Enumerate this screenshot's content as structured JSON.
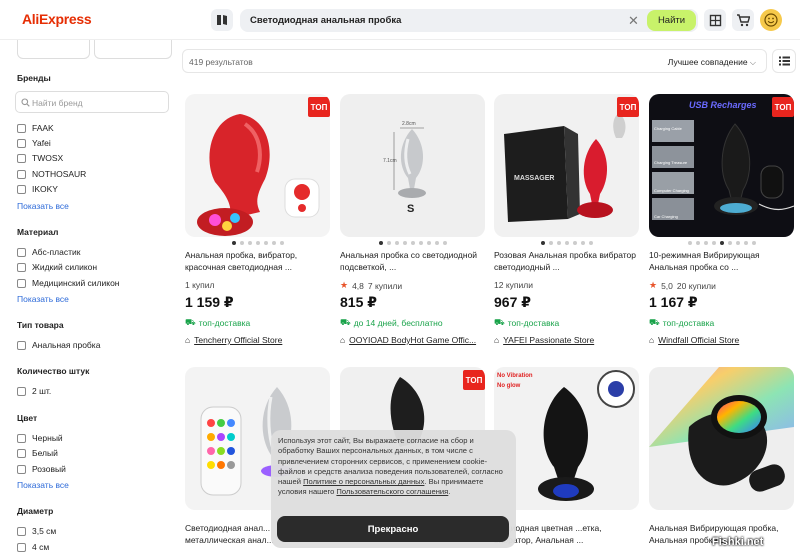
{
  "header": {
    "logo": "AliExpress",
    "search_value": "Светодиодная анальная пробка",
    "search_button": "Найти",
    "icons": [
      "catalog-icon",
      "clear-icon",
      "cart-icon",
      "favorites-icon",
      "user-icon"
    ]
  },
  "sidebar": {
    "brands": {
      "title": "Бренды",
      "search_placeholder": "Найти бренд",
      "items": [
        "FAAK",
        "Yafei",
        "TWOSX",
        "NOTHOSAUR",
        "IKOKY"
      ],
      "show_all": "Показать все"
    },
    "material": {
      "title": "Материал",
      "items": [
        "Абс-пластик",
        "Жидкий силикон",
        "Медицинский силикон"
      ],
      "show_all": "Показать все"
    },
    "product_type": {
      "title": "Тип товара",
      "items": [
        "Анальная пробка"
      ]
    },
    "quantity": {
      "title": "Количество штук",
      "items": [
        "2 шт."
      ]
    },
    "color": {
      "title": "Цвет",
      "items": [
        "Черный",
        "Белый",
        "Розовый"
      ],
      "show_all": "Показать все"
    },
    "diameter": {
      "title": "Диаметр",
      "items": [
        "3,5 см",
        "4 см"
      ]
    }
  },
  "results": {
    "count": "419 результатов",
    "sort": "Лучшее совпадение"
  },
  "products": [
    {
      "title": "Анальная пробка, вибратор, красочная светодиодная ...",
      "meta": "1 купил",
      "rating": "",
      "price": "1 159 ₽",
      "delivery": "топ-доставка",
      "store": "Tencherry Official Store",
      "top": "ТОП"
    },
    {
      "title": "Анальная пробка со светодиодной подсветкой, ...",
      "meta": "7 купили",
      "rating": "4,8",
      "price": "815 ₽",
      "delivery": "до 14 дней, бесплатно",
      "store": "OOYIOAD BodyHot Game Offic...",
      "top": ""
    },
    {
      "title": "Розовая Анальная пробка вибратор светодиодный ...",
      "meta": "12 купили",
      "rating": "",
      "price": "967 ₽",
      "delivery": "топ-доставка",
      "store": "YAFEI Passionate Store",
      "top": "ТОП"
    },
    {
      "title": "10-режимная Вибрирующая Анальная пробка со ...",
      "meta": "20 купили",
      "rating": "5,0",
      "price": "1 167 ₽",
      "delivery": "топ-доставка",
      "store": "Windfall Official Store",
      "top": "ТОП"
    },
    {
      "title": "Светодиодная анал... металлическая анал...",
      "top": ""
    },
    {
      "title": "",
      "top": "ТОП"
    },
    {
      "title": "...одиодная цветная ...етка, вибратор, Анальная ...",
      "top": ""
    },
    {
      "title": "Анальная Вибрирующая пробка, Анальная пробка с ...",
      "top": ""
    }
  ],
  "image_text": {
    "p2_dim1": "2.8cm",
    "p2_dim2": "7.1cm",
    "p2_size": "S",
    "p3_box": "MASSAGER",
    "p4_banner": "USB Recharges",
    "p4_labels": [
      "Charging Cable",
      "Charging Treasure",
      "Computer Charging",
      "Car Charging"
    ],
    "p7_labels": [
      "No Vibration",
      "No glow"
    ]
  },
  "cookie": {
    "text_1": "Используя этот сайт, Вы выражаете согласие на сбор и обработку Ваших персональных данных, в том числе с привлечением сторонних сервисов, с применением cookie-файлов и средств анализа поведения пользователей, согласно нашей ",
    "link_1": "Политике о персональных данных",
    "text_2": ". Вы принимаете условия нашего ",
    "link_2": "Пользовательского соглашения",
    "text_3": ".",
    "button": "Прекрасно"
  },
  "watermark": "Fishki.net",
  "colors": {
    "brand": "#e62e04",
    "search_button": "#c8f26a",
    "link": "#2e6bd9",
    "delivery": "#19a34a",
    "top_badge": "#e8251e"
  }
}
